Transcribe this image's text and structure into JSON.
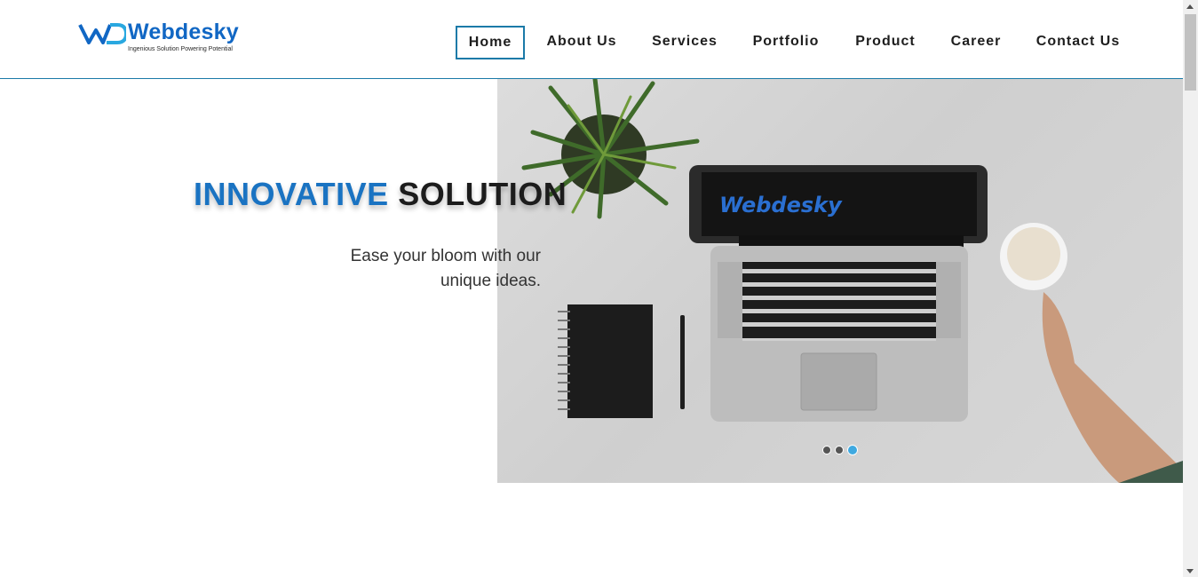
{
  "brand": {
    "name": "Webdesky",
    "tagline": "Ingenious Solution Powering Potential",
    "screen_text": "Webdesky",
    "colors": {
      "primary": "#1a73c2",
      "accent_border": "#1b7aa8",
      "dot_active": "#3fa9e0"
    }
  },
  "nav": {
    "items": [
      {
        "label": "Home",
        "active": true
      },
      {
        "label": "About Us",
        "active": false
      },
      {
        "label": "Services",
        "active": false
      },
      {
        "label": "Portfolio",
        "active": false
      },
      {
        "label": "Product",
        "active": false
      },
      {
        "label": "Career",
        "active": false
      },
      {
        "label": "Contact Us",
        "active": false
      }
    ]
  },
  "hero": {
    "headline_highlight": "INNOVATIVE",
    "headline_rest": "SOLUTION",
    "subtext": "Ease your bloom with our unique ideas.",
    "image_icon": "desk-laptop-illustration",
    "carousel": {
      "slides": 3,
      "active_index": 2
    }
  }
}
